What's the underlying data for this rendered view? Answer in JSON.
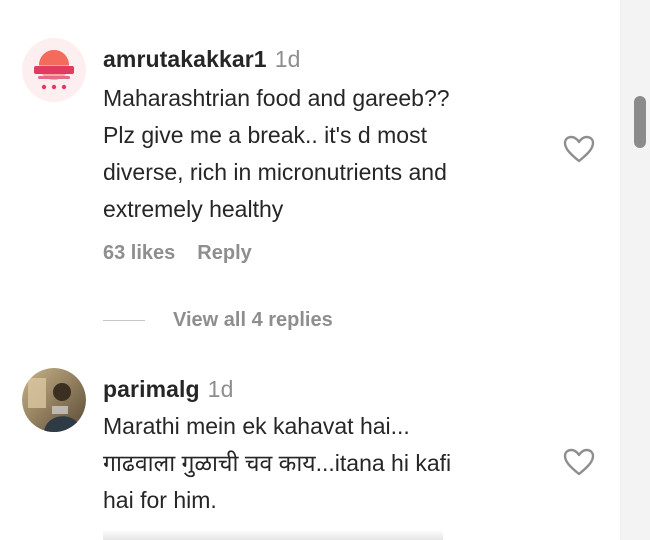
{
  "comments": [
    {
      "username": "amrutakakkar1",
      "time": "1d",
      "lines": [
        "Maharashtrian food and gareeb??",
        "Plz give me a break.. it's d most",
        "diverse, rich in micronutrients and",
        "extremely healthy"
      ],
      "likes": "63 likes",
      "reply_label": "Reply",
      "view_replies": "View all 4 replies",
      "avatar_icon": "brand-logo-avatar",
      "colors": {
        "avatar_accent": "#e23b62"
      }
    },
    {
      "username": "parimalg",
      "time": "1d",
      "lines": [
        "Marathi mein ek kahavat hai...",
        "गाढवाला गुळाची चव काय...itana hi kafi",
        "hai for him."
      ],
      "avatar_icon": "profile-photo-avatar",
      "colors": {
        "avatar_accent": "#7a6a4f"
      }
    }
  ],
  "icons": {
    "like": "heart-outline-icon"
  }
}
